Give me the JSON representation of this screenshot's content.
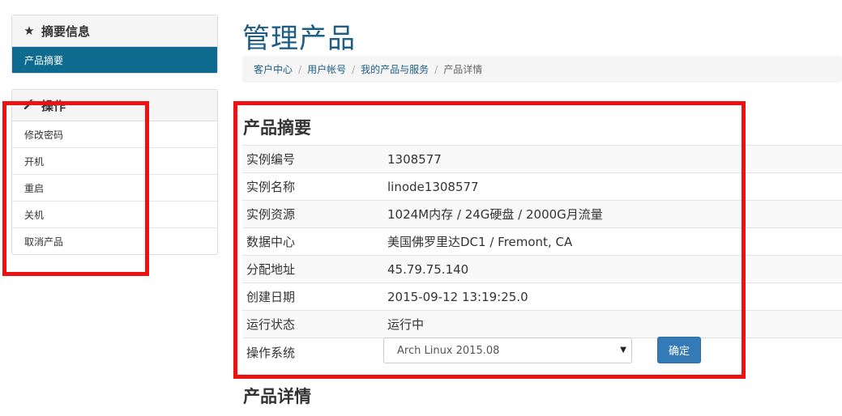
{
  "sidebar": {
    "summary_panel": {
      "icon": "star-icon",
      "title": "摘要信息",
      "active_item": "产品摘要"
    },
    "actions_panel": {
      "icon": "wrench-icon",
      "title": "操作",
      "items": [
        {
          "label": "修改密码"
        },
        {
          "label": "开机"
        },
        {
          "label": "重启"
        },
        {
          "label": "关机"
        },
        {
          "label": "取消产品"
        }
      ]
    }
  },
  "main": {
    "page_title": "管理产品",
    "breadcrumb": {
      "links": [
        "客户中心",
        "用户帐号",
        "我的产品与服务"
      ],
      "separator": "/",
      "current": "产品详情"
    },
    "summary": {
      "title": "产品摘要",
      "rows": [
        {
          "label": "实例编号",
          "value": "1308577"
        },
        {
          "label": "实例名称",
          "value": "linode1308577"
        },
        {
          "label": "实例资源",
          "value": "1024M内存 / 24G硬盘 / 2000G月流量"
        },
        {
          "label": "数据中心",
          "value": "美国佛罗里达DC1 / Fremont, CA"
        },
        {
          "label": "分配地址",
          "value": "45.79.75.140"
        },
        {
          "label": "创建日期",
          "value": "2015-09-12 13:19:25.0"
        },
        {
          "label": "运行状态",
          "value": "运行中"
        }
      ],
      "os_label": "操作系统",
      "os_selected": "Arch Linux 2015.08",
      "confirm_label": "确定"
    },
    "details_title": "产品详情"
  },
  "colors": {
    "accent": "#0e6a8f",
    "title": "#1e5e86",
    "button": "#337ab7",
    "highlight": "#ee1111"
  }
}
